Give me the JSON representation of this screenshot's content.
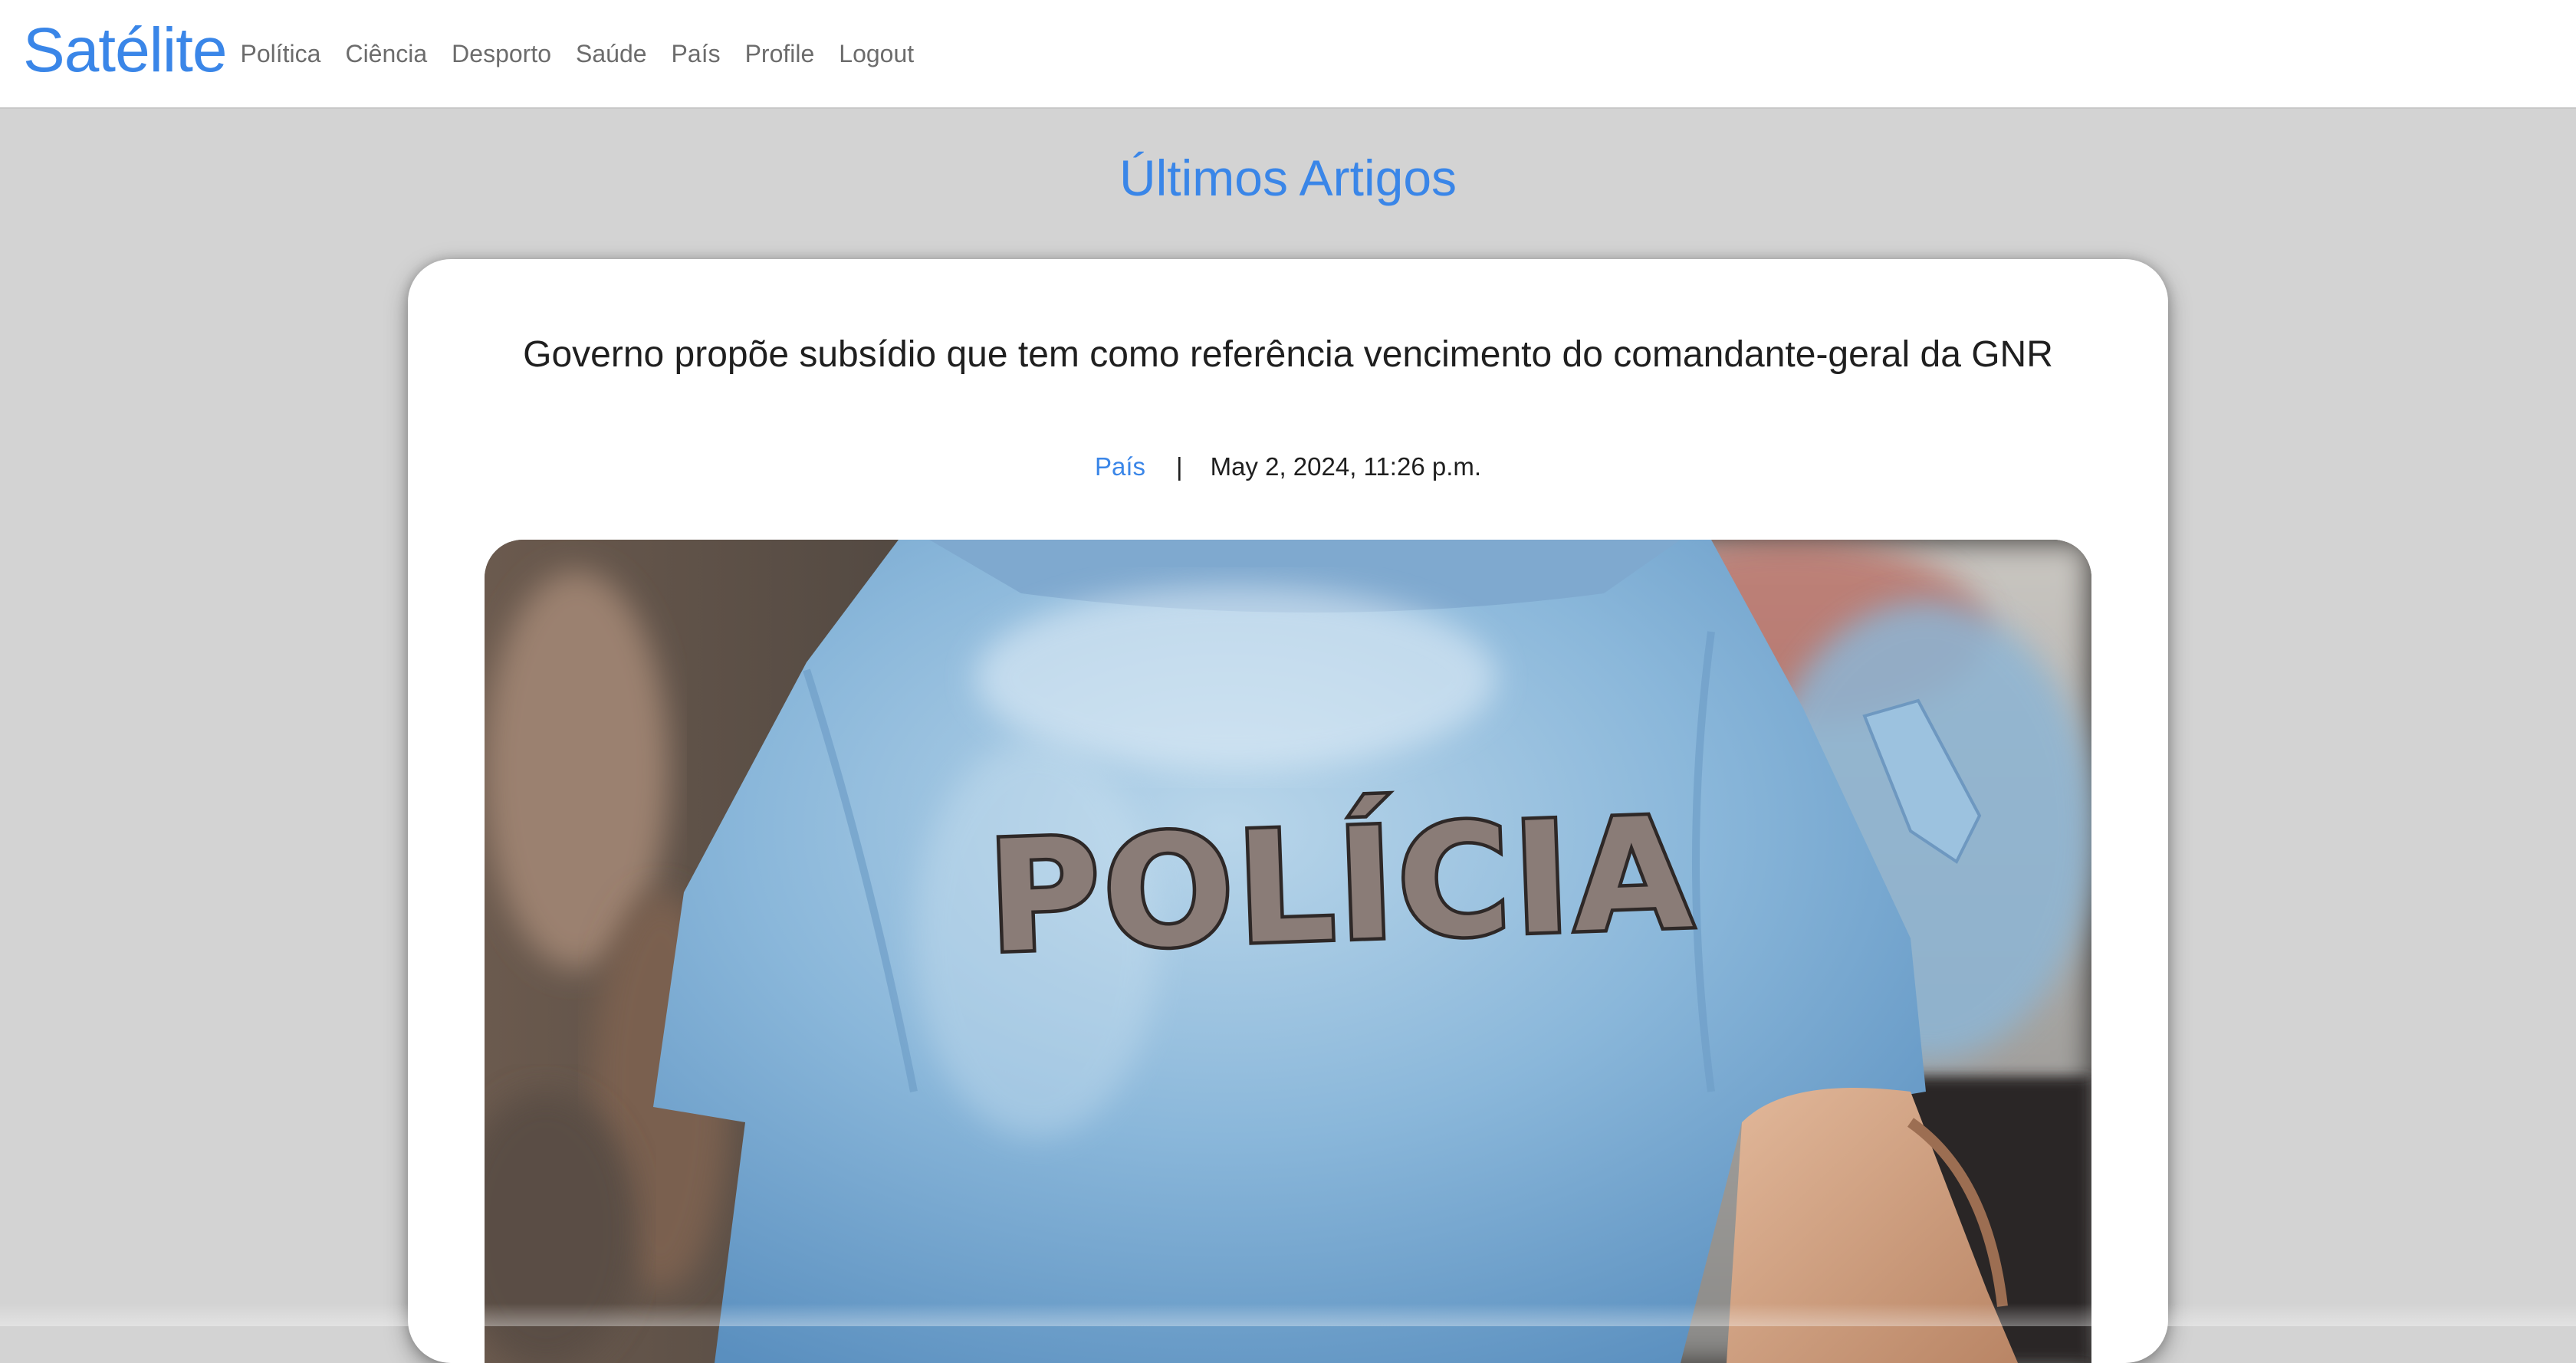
{
  "navbar": {
    "brand": "Satélite",
    "links": [
      {
        "label": "Política"
      },
      {
        "label": "Ciência"
      },
      {
        "label": "Desporto"
      },
      {
        "label": "Saúde"
      },
      {
        "label": "País"
      },
      {
        "label": "Profile"
      },
      {
        "label": "Logout"
      }
    ]
  },
  "main": {
    "heading": "Últimos Artigos",
    "article": {
      "title": "Governo propõe subsídio que tem como referência vencimento do comandante-geral da GNR",
      "category": "País",
      "separator": "|",
      "date": "May 2, 2024, 11:26 p.m.",
      "image_text": "POLÍCIA"
    }
  },
  "colors": {
    "accent": "#3a86e8",
    "background": "#d3d3d3",
    "card": "#ffffff",
    "nav_text": "#6c6c6c"
  }
}
